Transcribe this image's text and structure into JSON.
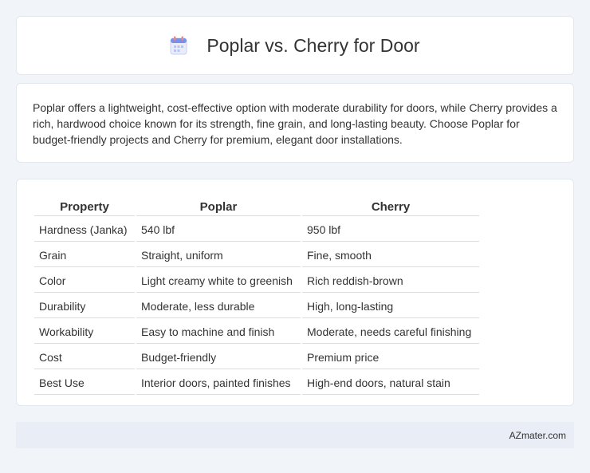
{
  "header": {
    "title": "Poplar vs. Cherry for Door",
    "icon": "calendar-icon"
  },
  "summary": {
    "text": "Poplar offers a lightweight, cost-effective option with moderate durability for doors, while Cherry provides a rich, hardwood choice known for its strength, fine grain, and long-lasting beauty. Choose Poplar for budget-friendly projects and Cherry for premium, elegant door installations."
  },
  "table": {
    "headers": [
      "Property",
      "Poplar",
      "Cherry"
    ],
    "rows": [
      [
        "Hardness (Janka)",
        "540 lbf",
        "950 lbf"
      ],
      [
        "Grain",
        "Straight, uniform",
        "Fine, smooth"
      ],
      [
        "Color",
        "Light creamy white to greenish",
        "Rich reddish-brown"
      ],
      [
        "Durability",
        "Moderate, less durable",
        "High, long-lasting"
      ],
      [
        "Workability",
        "Easy to machine and finish",
        "Moderate, needs careful finishing"
      ],
      [
        "Cost",
        "Budget-friendly",
        "Premium price"
      ],
      [
        "Best Use",
        "Interior doors, painted finishes",
        "High-end doors, natural stain"
      ]
    ]
  },
  "footer": {
    "text": "AZmater.com"
  }
}
